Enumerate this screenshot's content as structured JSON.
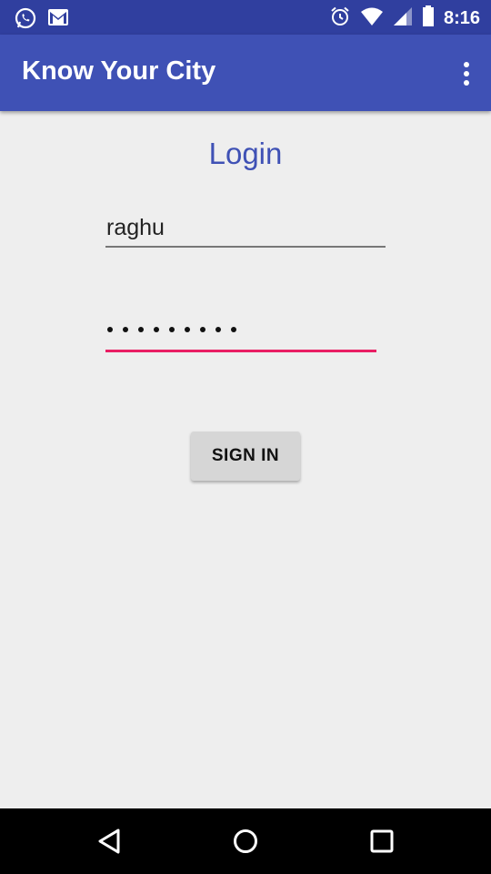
{
  "status_bar": {
    "time": "8:16",
    "left_icons": [
      "whatsapp-icon",
      "gmail-icon"
    ],
    "right_icons": [
      "alarm-icon",
      "wifi-icon",
      "signal-icon",
      "battery-icon"
    ]
  },
  "app_bar": {
    "title": "Know Your City",
    "overflow_icon": "more-vert-icon"
  },
  "login": {
    "heading": "Login",
    "username_value": "raghu",
    "password_masked": "•••••••••",
    "password_length": 9,
    "sign_in_label": "SIGN IN"
  },
  "nav_bar": {
    "icons": [
      "back-icon",
      "home-icon",
      "recents-icon"
    ]
  },
  "colors": {
    "status_bar": "#303f9f",
    "app_bar": "#3f51b5",
    "accent": "#e91e63",
    "background": "#eeeeee"
  }
}
